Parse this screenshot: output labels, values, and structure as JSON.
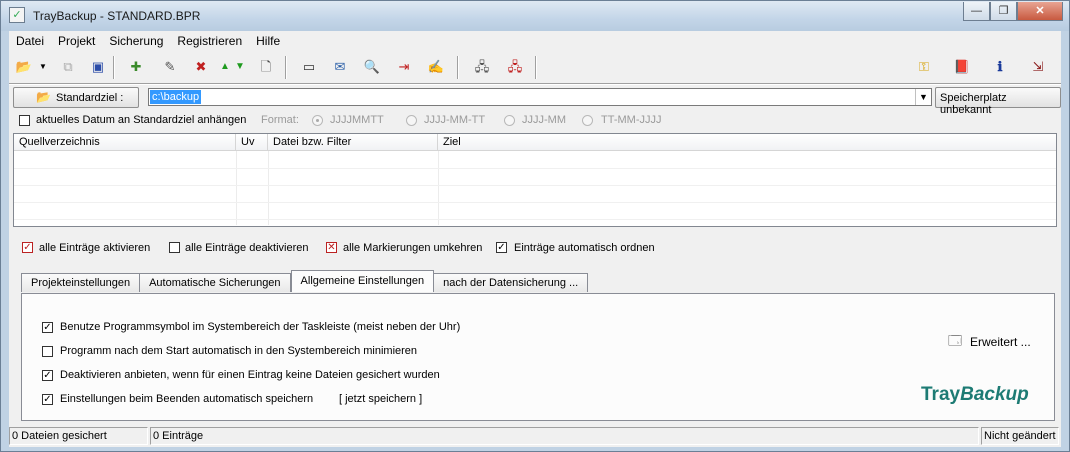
{
  "window": {
    "title": "TrayBackup  -  STANDARD.BPR",
    "minimize": "—",
    "maximize": "❐",
    "close": "✕"
  },
  "menu": [
    "Datei",
    "Projekt",
    "Sicherung",
    "Registrieren",
    "Hilfe"
  ],
  "toolbar": {
    "icons": [
      "open-folder-icon",
      "dropdown-arrow-icon",
      "copy-project-icon",
      "save-project-icon",
      "add-entry-icon",
      "edit-entry-icon",
      "remove-entry-icon",
      "move-up-icon",
      "move-down-icon",
      "new-document-icon",
      "view-icon",
      "mail-icon",
      "search-icon",
      "export-icon",
      "notes-icon",
      "network-drive-icon",
      "network-drive-disconnect-icon",
      "key-icon",
      "book-icon",
      "info-icon",
      "exit-icon"
    ]
  },
  "target": {
    "button_label": "Standardziel :",
    "path_value": "c:\\backup",
    "storage_status": "Speicherplatz unbekannt"
  },
  "date_options": {
    "checkbox_label": "aktuelles Datum an Standardziel anhängen",
    "format_label": "Format:",
    "formats": [
      "JJJJMMTT",
      "JJJJ-MM-TT",
      "JJJJ-MM",
      "TT-MM-JJJJ"
    ]
  },
  "list": {
    "columns": [
      "Quellverzeichnis",
      "Uv",
      "Datei  bzw. Filter",
      "Ziel"
    ],
    "rows": []
  },
  "list_actions": {
    "activate_all": "alle Einträge aktivieren",
    "deactivate_all": "alle Einträge deaktivieren",
    "invert_marks": "alle Markierungen umkehren",
    "auto_sort": "Einträge automatisch ordnen"
  },
  "tabs": [
    "Projekteinstellungen",
    "Automatische Sicherungen",
    "Allgemeine Einstellungen",
    "nach der Datensicherung ..."
  ],
  "general_settings": {
    "opt1": "Benutze Programmsymbol im Systembereich der Taskleiste (meist neben der Uhr)",
    "opt2": "Programm nach dem Start automatisch in den Systembereich minimieren",
    "opt3": "Deaktivieren anbieten, wenn für einen Eintrag keine Dateien gesichert wurden",
    "opt4": "Einstellungen beim Beenden automatisch speichern",
    "save_now": "[ jetzt speichern ]",
    "advanced": "Erweitert ...",
    "brand_tray": "Tray",
    "brand_backup": "Backup"
  },
  "status": {
    "files": "0 Dateien gesichert",
    "entries": "0 Einträge",
    "changed": "Nicht geändert"
  }
}
